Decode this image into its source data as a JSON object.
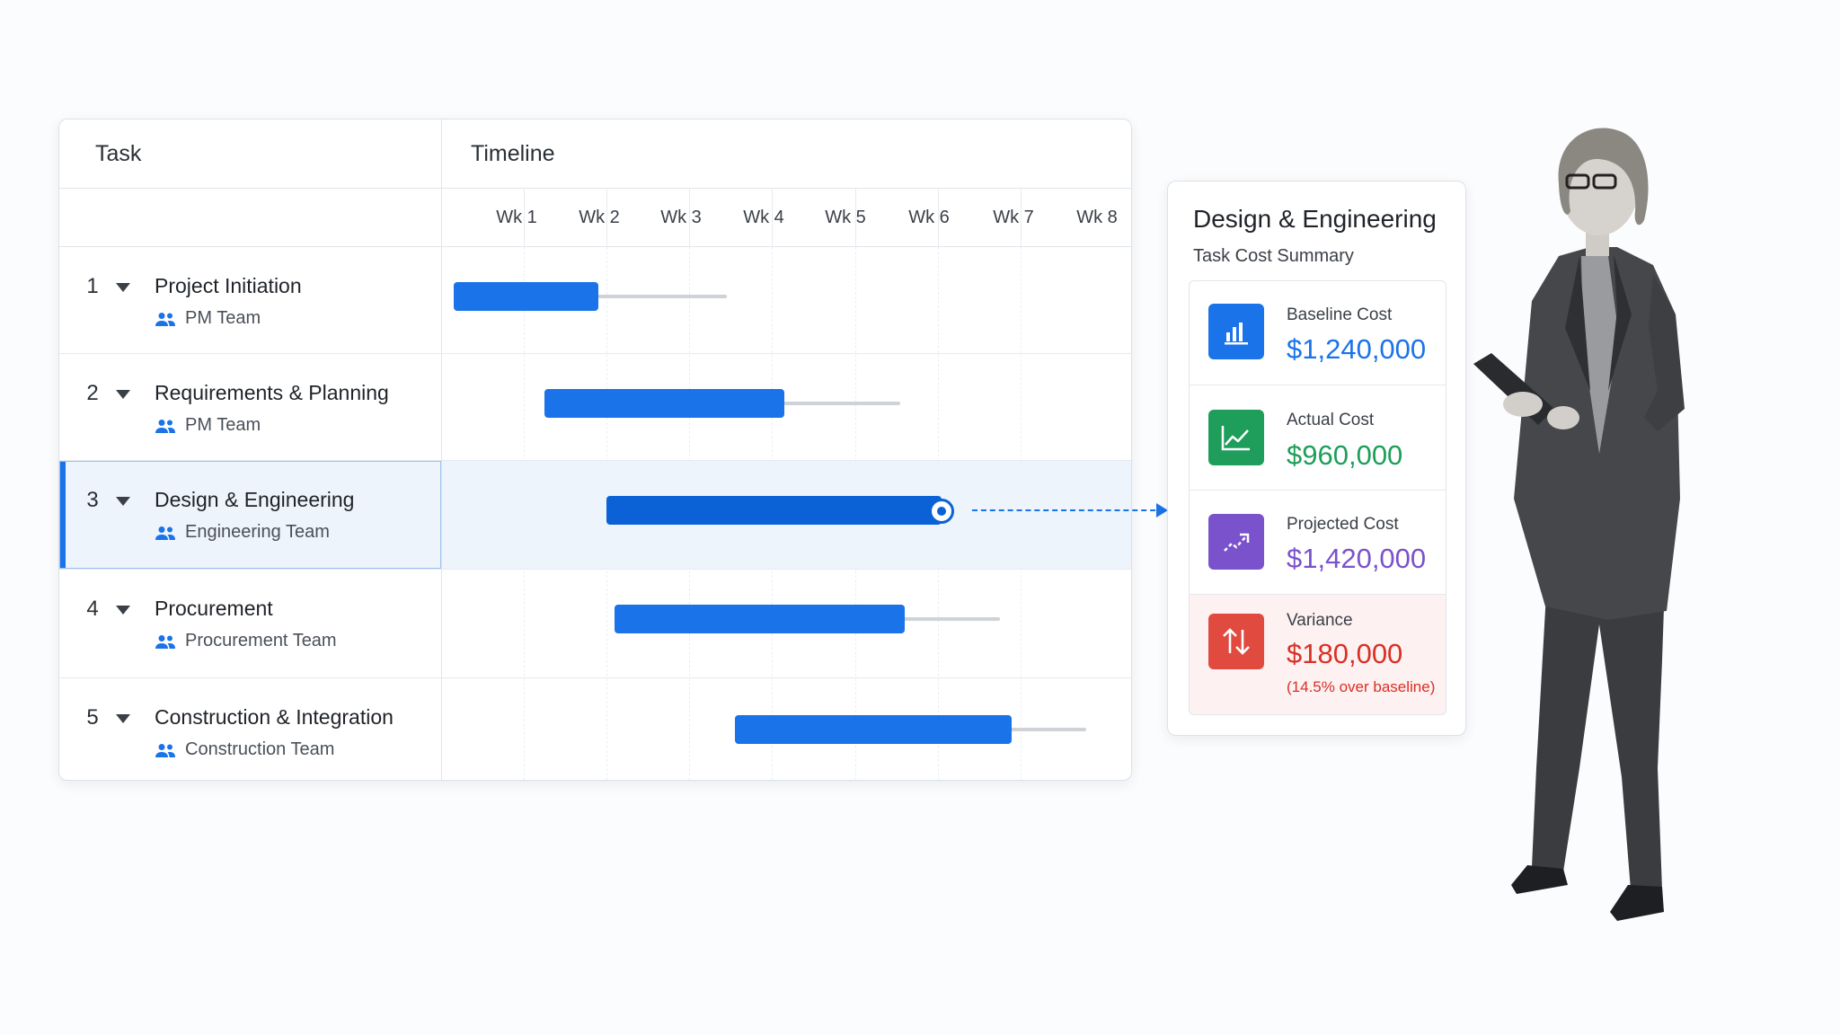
{
  "colors": {
    "accent": "#1a73e8",
    "active_bar": "#0b62d6",
    "baseline": "#1a73e8",
    "actual": "#1e9e5a",
    "projected": "#7a52cc",
    "variance": "#d93025"
  },
  "gantt": {
    "task_header": "Task",
    "timeline_header": "Timeline",
    "weeks": [
      "Wk 1",
      "Wk 2",
      "Wk 3",
      "Wk 4",
      "Wk 5",
      "Wk 6",
      "Wk 7",
      "Wk 8"
    ],
    "team_icon": "people-icon",
    "caret_icon": "caret-down-icon",
    "tasks": [
      {
        "num": "1",
        "name": "Project Initiation",
        "team": "PM Team",
        "start_week": 1.15,
        "end_week": 2.9,
        "slack_end_week": 4.45
      },
      {
        "num": "2",
        "name": "Requirements & Planning",
        "team": "PM Team",
        "start_week": 2.25,
        "end_week": 5.15,
        "slack_end_week": 6.55
      },
      {
        "num": "3",
        "name": "Design & Engineering",
        "team": "Engineering Team",
        "start_week": 3.0,
        "end_week": 7.05,
        "slack_end_week": 7.05,
        "selected": true
      },
      {
        "num": "4",
        "name": "Procurement",
        "team": "Procurement Team",
        "start_week": 3.1,
        "end_week": 6.6,
        "slack_end_week": 7.75
      },
      {
        "num": "5",
        "name": "Construction & Integration",
        "team": "Construction Team",
        "start_week": 4.55,
        "end_week": 7.9,
        "slack_end_week": 8.8
      }
    ]
  },
  "cost_summary": {
    "title": "Design & Engineering",
    "subtitle": "Task Cost Summary",
    "items": [
      {
        "key": "baseline",
        "label": "Baseline Cost",
        "value": "$1,240,000",
        "icon": "bar-chart-icon"
      },
      {
        "key": "actual",
        "label": "Actual Cost",
        "value": "$960,000",
        "icon": "line-chart-icon"
      },
      {
        "key": "projected",
        "label": "Projected Cost",
        "value": "$1,420,000",
        "icon": "trend-up-icon"
      },
      {
        "key": "variance",
        "label": "Variance",
        "value": "$180,000",
        "note": "(14.5% over baseline)",
        "icon": "up-down-arrows-icon"
      }
    ]
  }
}
